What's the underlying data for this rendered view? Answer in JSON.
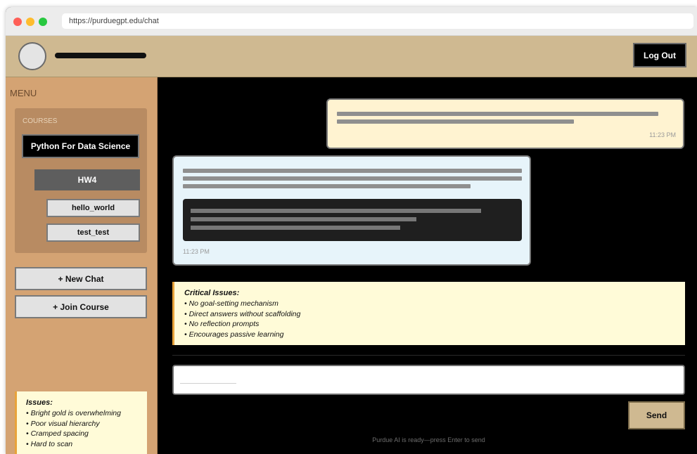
{
  "browser": {
    "url": "https://purduegpt.edu/chat"
  },
  "header": {
    "logout_label": "Log Out"
  },
  "sidebar": {
    "menu_label": "MENU",
    "courses_label": "COURSES",
    "course_name": "Python For Data Science",
    "assignment": "HW4",
    "chats": [
      "hello_world",
      "test_test"
    ],
    "new_chat_label": "+ New Chat",
    "join_course_label": "+ Join Course",
    "issues": {
      "title": "Issues:",
      "items": [
        "• Bright gold is overwhelming",
        "• Poor visual hierarchy",
        "• Cramped spacing",
        "• Hard to scan"
      ]
    }
  },
  "chat": {
    "user_message_time": "11:23 PM",
    "bot_message_time": "11:23 PM",
    "critical": {
      "title": "Critical Issues:",
      "items": [
        "• No goal-setting mechanism",
        "• Direct answers without scaffolding",
        "• No reflection prompts",
        "• Encourages passive learning"
      ]
    },
    "send_label": "Send",
    "status": "Purdue AI is ready—press Enter to send"
  },
  "colors": {
    "header_gold": "#cfb991",
    "sidebar_tan": "#d4a373",
    "note_yellow": "#fffbd8",
    "note_accent": "#e8a33a"
  }
}
